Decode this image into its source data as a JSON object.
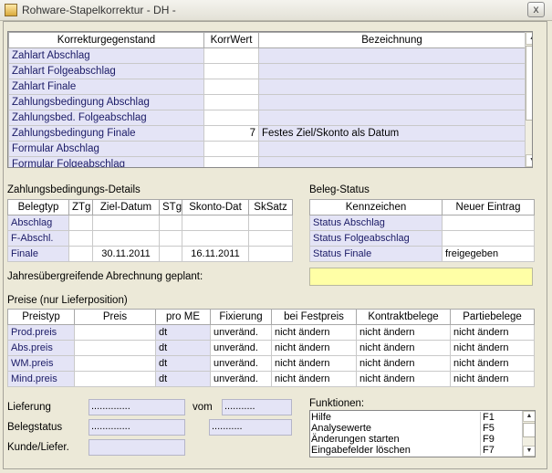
{
  "window": {
    "title": "Rohware-Stapelkorrektur - DH -",
    "close_glyph": "x"
  },
  "main_table": {
    "headers": [
      "Korrekturgegenstand",
      "KorrWert",
      "Bezeichnung"
    ],
    "rows": [
      {
        "label": "Zahlart Abschlag",
        "value": "",
        "desc": ""
      },
      {
        "label": "Zahlart Folgeabschlag",
        "value": "",
        "desc": ""
      },
      {
        "label": "Zahlart Finale",
        "value": "",
        "desc": ""
      },
      {
        "label": "Zahlungsbedingung Abschlag",
        "value": "",
        "desc": ""
      },
      {
        "label": "Zahlungsbed. Folgeabschlag",
        "value": "",
        "desc": ""
      },
      {
        "label": "Zahlungsbedingung Finale",
        "value": "7",
        "desc": "Festes Ziel/Skonto als Datum"
      },
      {
        "label": "Formular Abschlag",
        "value": "",
        "desc": ""
      },
      {
        "label": "Formular Folgeabschlag",
        "value": "",
        "desc": ""
      }
    ]
  },
  "zahlung": {
    "title": "Zahlungsbedingungs-Details",
    "headers": [
      "Belegtyp",
      "ZTg",
      "Ziel-Datum",
      "STg",
      "Skonto-Dat",
      "SkSatz"
    ],
    "rows": [
      {
        "typ": "Abschlag",
        "ztg": "",
        "ziel": "",
        "stg": "",
        "skonto": "",
        "satz": ""
      },
      {
        "typ": "F-Abschl.",
        "ztg": "",
        "ziel": "",
        "stg": "",
        "skonto": "",
        "satz": ""
      },
      {
        "typ": "Finale",
        "ztg": "",
        "ziel": "30.11.2011",
        "stg": "",
        "skonto": "16.11.2011",
        "satz": ""
      }
    ]
  },
  "beleg": {
    "title": "Beleg-Status",
    "headers": [
      "Kennzeichen",
      "Neuer Eintrag"
    ],
    "rows": [
      {
        "kenn": "Status Abschlag",
        "neu": ""
      },
      {
        "kenn": "Status Folgeabschlag",
        "neu": ""
      },
      {
        "kenn": "Status Finale",
        "neu": "freigegeben"
      }
    ]
  },
  "jahres": {
    "label": "Jahresübergreifende Abrechnung geplant:",
    "value": ""
  },
  "preise": {
    "title": "Preise (nur Lieferposition)",
    "headers": [
      "Preistyp",
      "Preis",
      "pro ME",
      "Fixierung",
      "bei Festpreis",
      "Kontraktbelege",
      "Partiebelege"
    ],
    "rows": [
      {
        "typ": "Prod.preis",
        "preis": "",
        "me": "dt",
        "fix": "unveränd.",
        "fest": "nicht ändern",
        "kontrakt": "nicht ändern",
        "partie": "nicht ändern"
      },
      {
        "typ": "Abs.preis",
        "preis": "",
        "me": "dt",
        "fix": "unveränd.",
        "fest": "nicht ändern",
        "kontrakt": "nicht ändern",
        "partie": "nicht ändern"
      },
      {
        "typ": "WM.preis",
        "preis": "",
        "me": "dt",
        "fix": "unveränd.",
        "fest": "nicht ändern",
        "kontrakt": "nicht ändern",
        "partie": "nicht ändern"
      },
      {
        "typ": "Mind.preis",
        "preis": "",
        "me": "dt",
        "fix": "unveränd.",
        "fest": "nicht ändern",
        "kontrakt": "nicht ändern",
        "partie": "nicht ändern"
      }
    ]
  },
  "filters": {
    "lieferung_label": "Lieferung",
    "lieferung_value": "..............",
    "vom_label": "vom",
    "vom_value": "...........",
    "belegstatus_label": "Belegstatus",
    "belegstatus_value": "..............",
    "belegstatus_value2": "...........",
    "kunde_label": "Kunde/Liefer.",
    "kunde_value": ""
  },
  "funktionen": {
    "title": "Funktionen:",
    "items": [
      {
        "name": "Hilfe",
        "key": "F1"
      },
      {
        "name": "Analysewerte",
        "key": "F5"
      },
      {
        "name": "Änderungen starten",
        "key": "F9"
      },
      {
        "name": "Eingabefelder löschen",
        "key": "F7"
      }
    ]
  }
}
